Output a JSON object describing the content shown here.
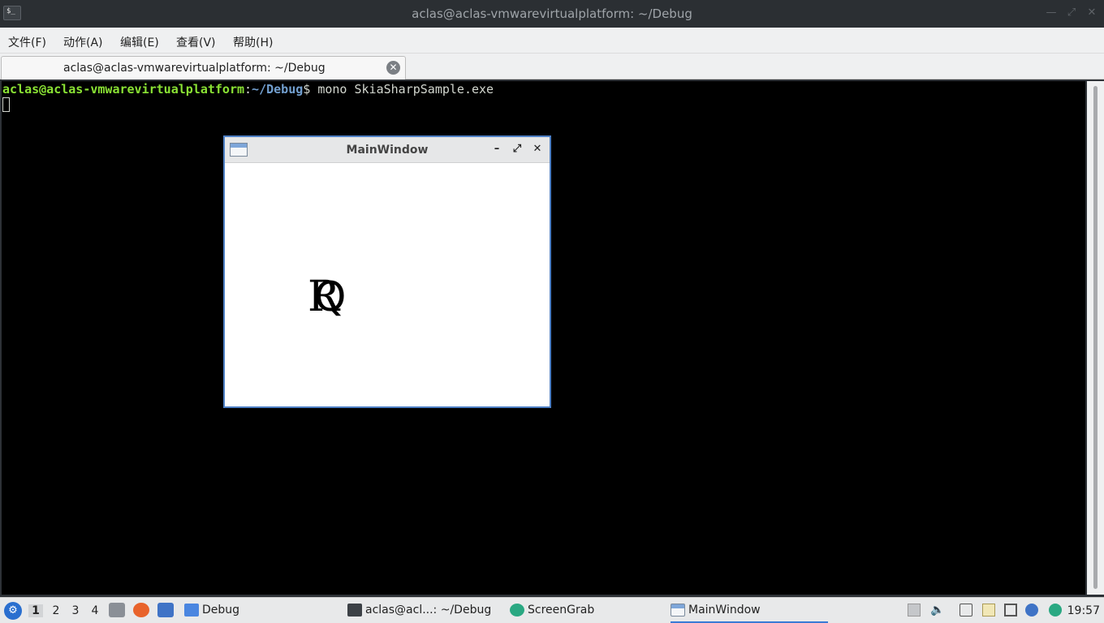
{
  "window": {
    "title": "aclas@aclas-vmwarevirtualplatform: ~/Debug",
    "app_icon_glyph": "$_"
  },
  "menubar": {
    "items": [
      "文件(F)",
      "动作(A)",
      "编辑(E)",
      "查看(V)",
      "帮助(H)"
    ]
  },
  "tabs": [
    {
      "label": "aclas@aclas-vmwarevirtualplatform: ~/Debug",
      "close_icon": "close-circle-icon"
    }
  ],
  "terminal": {
    "prompt_user": "aclas@aclas-vmwarevirtualplatform",
    "prompt_colon": ":",
    "prompt_path": "~/Debug",
    "prompt_symbol": "$",
    "command": " mono SkiaSharpSample.exe"
  },
  "main_window": {
    "title": "MainWindow",
    "minimize": "–",
    "maximize": "⤢",
    "close": "✕",
    "canvas_text": "R",
    "canvas_text_overlay": "Q"
  },
  "taskbar": {
    "workspaces": [
      "1",
      "2",
      "3",
      "4"
    ],
    "active_workspace": "1",
    "tasks": [
      {
        "label": "Debug",
        "icon": "folder-icon"
      },
      {
        "label": "aclas@acl...: ~/Debug",
        "icon": "terminal-icon"
      },
      {
        "label": "ScreenGrab",
        "icon": "screengrab-icon"
      },
      {
        "label": "MainWindow",
        "icon": "window-icon"
      }
    ],
    "clock": "19:57"
  },
  "colors": {
    "prompt_user": "#8ae234",
    "prompt_path": "#729fcf",
    "window_border": "#4d7fc4",
    "taskbar_active": "#3a7bd5"
  }
}
